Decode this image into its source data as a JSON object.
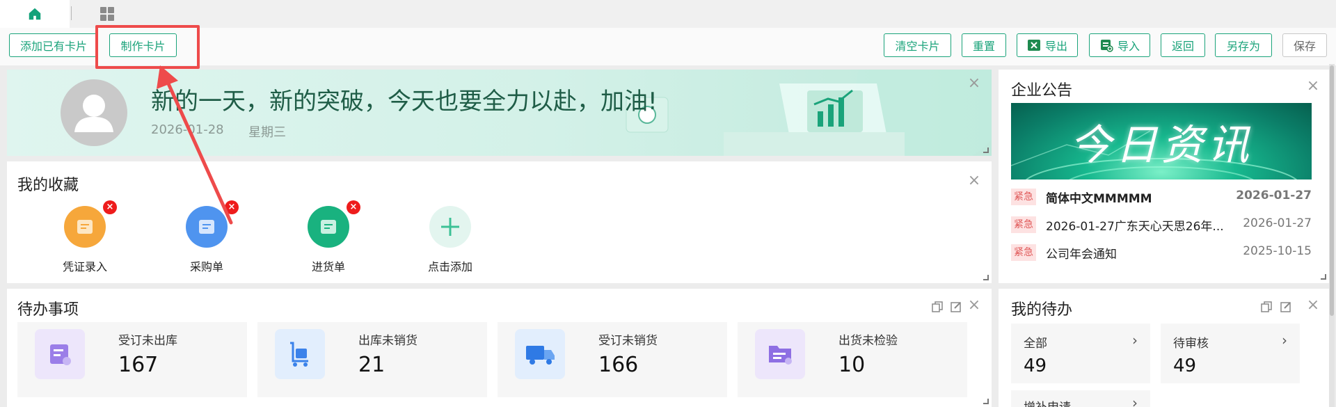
{
  "tabs": {
    "home_icon": "home-icon",
    "apps_icon": "grid-icon"
  },
  "toolbar": {
    "add_existing": "添加已有卡片",
    "make_card": "制作卡片",
    "clear_cards": "清空卡片",
    "reset": "重置",
    "export": "导出",
    "import": "导入",
    "back": "返回",
    "save_as": "另存为",
    "save": "保存"
  },
  "banner": {
    "greeting": "新的一天，新的突破，今天也要全力以赴，加油!",
    "date": "2026-01-28",
    "weekday": "星期三"
  },
  "favorites": {
    "title": "我的收藏",
    "items": [
      {
        "label": "凭证录入",
        "color": "#f6a73b"
      },
      {
        "label": "采购单",
        "color": "#4f94ef"
      },
      {
        "label": "进货单",
        "color": "#19b27f"
      },
      {
        "label": "点击添加",
        "color": "#e3f5ef"
      }
    ]
  },
  "notice": {
    "title": "企业公告",
    "image_text": "今日资讯",
    "rows": [
      {
        "tag": "紧急",
        "text": "简体中文MMMMM",
        "date": "2026-01-27"
      },
      {
        "tag": "紧急",
        "text": "2026-01-27广东天心天思26年...",
        "date": "2026-01-27"
      },
      {
        "tag": "紧急",
        "text": "公司年会通知",
        "date": "2025-10-15"
      }
    ]
  },
  "todo": {
    "title": "待办事项",
    "tiles": [
      {
        "label": "受订未出库",
        "count": "167"
      },
      {
        "label": "出库未销货",
        "count": "21"
      },
      {
        "label": "受订未销货",
        "count": "166"
      },
      {
        "label": "出货未检验",
        "count": "10"
      }
    ]
  },
  "mytodo": {
    "title": "我的待办",
    "tiles": [
      {
        "label": "全部",
        "count": "49"
      },
      {
        "label": "待审核",
        "count": "49"
      }
    ],
    "partial_label": "增补申请"
  },
  "colors": {
    "accent": "#1aa37a",
    "highlight": "#ee4b4b",
    "urgent_bg": "#fde2e2"
  }
}
